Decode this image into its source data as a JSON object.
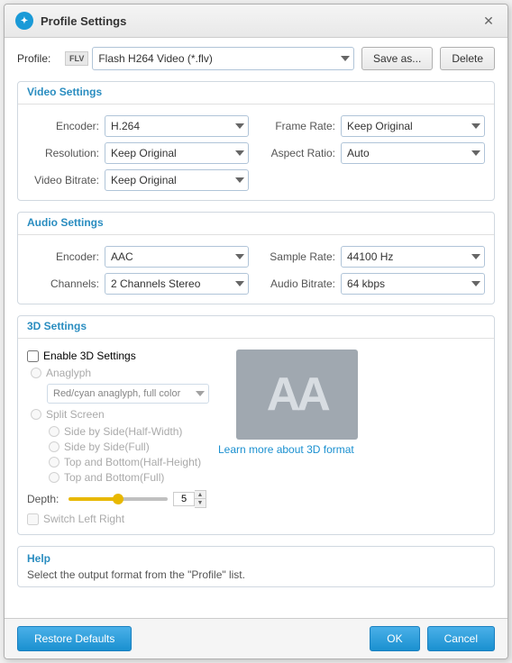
{
  "dialog": {
    "title": "Profile Settings",
    "close_label": "✕"
  },
  "profile": {
    "label": "Profile:",
    "value": "Flash H264 Video (*.flv)",
    "save_as": "Save as...",
    "delete": "Delete",
    "flv_text": "FLV"
  },
  "video_settings": {
    "title": "Video Settings",
    "encoder_label": "Encoder:",
    "encoder_value": "H.264",
    "frame_rate_label": "Frame Rate:",
    "frame_rate_value": "Keep Original",
    "resolution_label": "Resolution:",
    "resolution_value": "Keep Original",
    "aspect_ratio_label": "Aspect Ratio:",
    "aspect_ratio_value": "Auto",
    "video_bitrate_label": "Video Bitrate:",
    "video_bitrate_value": "Keep Original"
  },
  "audio_settings": {
    "title": "Audio Settings",
    "encoder_label": "Encoder:",
    "encoder_value": "AAC",
    "sample_rate_label": "Sample Rate:",
    "sample_rate_value": "44100 Hz",
    "channels_label": "Channels:",
    "channels_value": "2 Channels Stereo",
    "audio_bitrate_label": "Audio Bitrate:",
    "audio_bitrate_value": "64 kbps"
  },
  "settings_3d": {
    "title": "3D Settings",
    "enable_label": "Enable 3D Settings",
    "anaglyph_label": "Anaglyph",
    "anaglyph_option": "Red/cyan anaglyph, full color",
    "split_screen_label": "Split Screen",
    "side_by_side_half": "Side by Side(Half-Width)",
    "side_by_side_full": "Side by Side(Full)",
    "top_bottom_half": "Top and Bottom(Half-Height)",
    "top_bottom_full": "Top and Bottom(Full)",
    "depth_label": "Depth:",
    "depth_value": "5",
    "switch_label": "Switch Left Right",
    "learn_more": "Learn more about 3D format",
    "preview_text": "AA"
  },
  "help": {
    "title": "Help",
    "text": "Select the output format from the \"Profile\" list."
  },
  "footer": {
    "restore": "Restore Defaults",
    "ok": "OK",
    "cancel": "Cancel"
  }
}
